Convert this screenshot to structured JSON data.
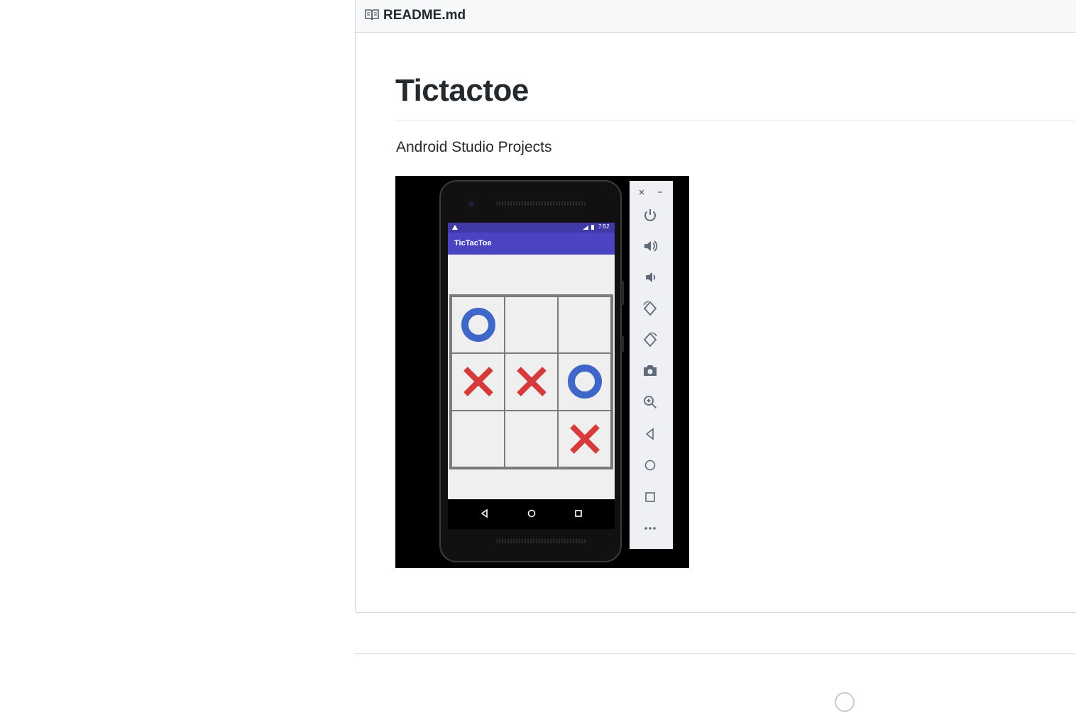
{
  "readme": {
    "header": {
      "filename": "README.md",
      "icon": "book-icon"
    },
    "title": "Tictactoe",
    "description": "Android Studio Projects"
  },
  "emulator": {
    "status_time": "7:52",
    "app_title": "TicTacToe",
    "board": [
      [
        "O",
        "",
        ""
      ],
      [
        "X",
        "X",
        "O"
      ],
      [
        "",
        "",
        "X"
      ]
    ],
    "colors": {
      "status_bar": "#3f3aa8",
      "app_bar": "#4a44c3",
      "o_mark": "#3f67c9",
      "x_mark": "#d63a3a"
    },
    "nav_buttons": [
      "back-icon",
      "home-icon",
      "recents-icon"
    ],
    "toolbar": {
      "window_controls": [
        "close-icon",
        "minimize-icon"
      ],
      "buttons": [
        "power-icon",
        "volume-up-icon",
        "volume-down-icon",
        "rotate-left-icon",
        "rotate-right-icon",
        "camera-icon",
        "zoom-icon",
        "back-icon",
        "home-icon",
        "overview-icon",
        "more-icon"
      ]
    }
  }
}
